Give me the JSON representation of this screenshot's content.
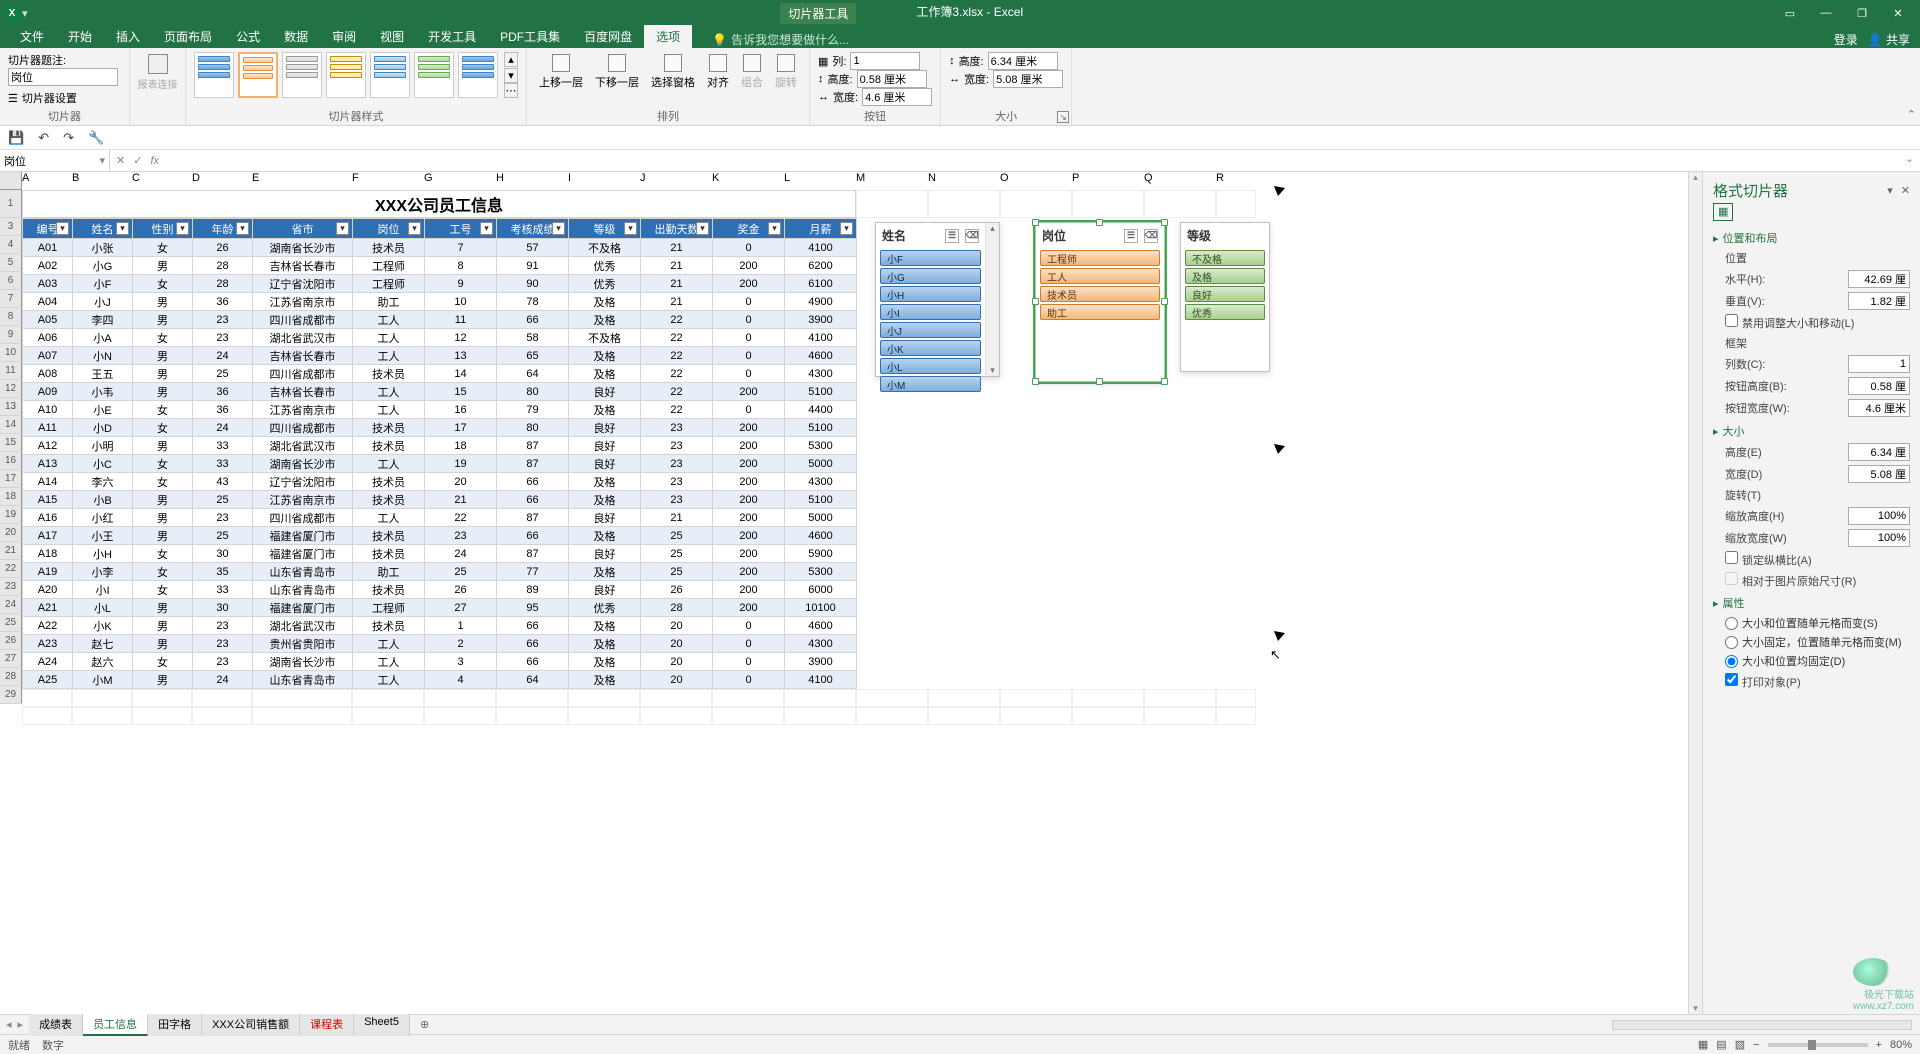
{
  "window": {
    "slicer_tool_tab": "切片器工具",
    "title": "工作簿3.xlsx - Excel",
    "login": "登录",
    "share": "共享"
  },
  "ribbon_tabs": {
    "file": "文件",
    "home": "开始",
    "insert": "插入",
    "page_layout": "页面布局",
    "formulas": "公式",
    "data": "数据",
    "review": "审阅",
    "view": "视图",
    "developer": "开发工具",
    "pdf": "PDF工具集",
    "baidu": "百度网盘",
    "options": "选项",
    "tell_me": "告诉我您想要做什么..."
  },
  "ribbon": {
    "slicer_caption_label": "切片器题注:",
    "slicer_caption_value": "岗位",
    "slicer_settings": "切片器设置",
    "report_connections": "报表连接",
    "group_slicer": "切片器",
    "group_styles": "切片器样式",
    "bring_forward": "上移一层",
    "send_backward": "下移一层",
    "selection_pane": "选择窗格",
    "align": "对齐",
    "group": "组合",
    "rotate": "旋转",
    "group_arrange": "排列",
    "columns_label": "列:",
    "columns_value": "1",
    "btn_height_label": "高度:",
    "btn_height_value": "0.58 厘米",
    "btn_width_label": "宽度:",
    "btn_width_value": "4.6 厘米",
    "group_buttons": "按钮",
    "size_height_label": "高度:",
    "size_height_value": "6.34 厘米",
    "size_width_label": "宽度:",
    "size_width_value": "5.08 厘米",
    "group_size": "大小"
  },
  "name_box": "岗位",
  "fx_label": "fx",
  "columns": [
    "A",
    "B",
    "C",
    "D",
    "E",
    "F",
    "G",
    "H",
    "I",
    "J",
    "K",
    "L",
    "M",
    "N",
    "O",
    "P",
    "Q",
    "R"
  ],
  "table": {
    "title": "XXX公司员工信息",
    "headers": [
      "编号",
      "姓名",
      "性别",
      "年龄",
      "省市",
      "岗位",
      "工号",
      "考核成绩",
      "等级",
      "出勤天数",
      "奖金",
      "月薪"
    ],
    "rows": [
      [
        "A01",
        "小张",
        "女",
        "26",
        "湖南省长沙市",
        "技术员",
        "7",
        "57",
        "不及格",
        "21",
        "0",
        "4100"
      ],
      [
        "A02",
        "小G",
        "男",
        "28",
        "吉林省长春市",
        "工程师",
        "8",
        "91",
        "优秀",
        "21",
        "200",
        "6200"
      ],
      [
        "A03",
        "小F",
        "女",
        "28",
        "辽宁省沈阳市",
        "工程师",
        "9",
        "90",
        "优秀",
        "21",
        "200",
        "6100"
      ],
      [
        "A04",
        "小J",
        "男",
        "36",
        "江苏省南京市",
        "助工",
        "10",
        "78",
        "及格",
        "21",
        "0",
        "4900"
      ],
      [
        "A05",
        "李四",
        "男",
        "23",
        "四川省成都市",
        "工人",
        "11",
        "66",
        "及格",
        "22",
        "0",
        "3900"
      ],
      [
        "A06",
        "小A",
        "女",
        "23",
        "湖北省武汉市",
        "工人",
        "12",
        "58",
        "不及格",
        "22",
        "0",
        "4100"
      ],
      [
        "A07",
        "小N",
        "男",
        "24",
        "吉林省长春市",
        "工人",
        "13",
        "65",
        "及格",
        "22",
        "0",
        "4600"
      ],
      [
        "A08",
        "王五",
        "男",
        "25",
        "四川省成都市",
        "技术员",
        "14",
        "64",
        "及格",
        "22",
        "0",
        "4300"
      ],
      [
        "A09",
        "小韦",
        "男",
        "36",
        "吉林省长春市",
        "工人",
        "15",
        "80",
        "良好",
        "22",
        "200",
        "5100"
      ],
      [
        "A10",
        "小E",
        "女",
        "36",
        "江苏省南京市",
        "工人",
        "16",
        "79",
        "及格",
        "22",
        "0",
        "4400"
      ],
      [
        "A11",
        "小D",
        "女",
        "24",
        "四川省成都市",
        "技术员",
        "17",
        "80",
        "良好",
        "23",
        "200",
        "5100"
      ],
      [
        "A12",
        "小明",
        "男",
        "33",
        "湖北省武汉市",
        "技术员",
        "18",
        "87",
        "良好",
        "23",
        "200",
        "5300"
      ],
      [
        "A13",
        "小C",
        "女",
        "33",
        "湖南省长沙市",
        "工人",
        "19",
        "87",
        "良好",
        "23",
        "200",
        "5000"
      ],
      [
        "A14",
        "李六",
        "女",
        "43",
        "辽宁省沈阳市",
        "技术员",
        "20",
        "66",
        "及格",
        "23",
        "200",
        "4300"
      ],
      [
        "A15",
        "小B",
        "男",
        "25",
        "江苏省南京市",
        "技术员",
        "21",
        "66",
        "及格",
        "23",
        "200",
        "5100"
      ],
      [
        "A16",
        "小红",
        "男",
        "23",
        "四川省成都市",
        "工人",
        "22",
        "87",
        "良好",
        "21",
        "200",
        "5000"
      ],
      [
        "A17",
        "小王",
        "男",
        "25",
        "福建省厦门市",
        "技术员",
        "23",
        "66",
        "及格",
        "25",
        "200",
        "4600"
      ],
      [
        "A18",
        "小H",
        "女",
        "30",
        "福建省厦门市",
        "技术员",
        "24",
        "87",
        "良好",
        "25",
        "200",
        "5900"
      ],
      [
        "A19",
        "小李",
        "女",
        "35",
        "山东省青岛市",
        "助工",
        "25",
        "77",
        "及格",
        "25",
        "200",
        "5300"
      ],
      [
        "A20",
        "小I",
        "女",
        "33",
        "山东省青岛市",
        "技术员",
        "26",
        "89",
        "良好",
        "26",
        "200",
        "6000"
      ],
      [
        "A21",
        "小L",
        "男",
        "30",
        "福建省厦门市",
        "工程师",
        "27",
        "95",
        "优秀",
        "28",
        "200",
        "10100"
      ],
      [
        "A22",
        "小K",
        "男",
        "23",
        "湖北省武汉市",
        "技术员",
        "1",
        "66",
        "及格",
        "20",
        "0",
        "4600"
      ],
      [
        "A23",
        "赵七",
        "男",
        "23",
        "贵州省贵阳市",
        "工人",
        "2",
        "66",
        "及格",
        "20",
        "0",
        "4300"
      ],
      [
        "A24",
        "赵六",
        "女",
        "23",
        "湖南省长沙市",
        "工人",
        "3",
        "66",
        "及格",
        "20",
        "0",
        "3900"
      ],
      [
        "A25",
        "小M",
        "男",
        "24",
        "山东省青岛市",
        "工人",
        "4",
        "64",
        "及格",
        "20",
        "0",
        "4100"
      ]
    ]
  },
  "slicers": {
    "name": {
      "title": "姓名",
      "items": [
        "小F",
        "小G",
        "小H",
        "小I",
        "小J",
        "小K",
        "小L",
        "小M"
      ]
    },
    "position": {
      "title": "岗位",
      "items": [
        "工程师",
        "工人",
        "技术员",
        "助工"
      ]
    },
    "grade": {
      "title": "等级",
      "items": [
        "不及格",
        "及格",
        "良好",
        "优秀"
      ]
    }
  },
  "side_pane": {
    "title": "格式切片器",
    "sec_position": "位置和布局",
    "position_label": "位置",
    "horizontal": "水平(H):",
    "horizontal_val": "42.69 厘",
    "vertical": "垂直(V):",
    "vertical_val": "1.82 厘",
    "disable_resize": "禁用调整大小和移动(L)",
    "frame": "框架",
    "columns": "列数(C):",
    "columns_val": "1",
    "btn_height": "按钮高度(B):",
    "btn_height_val": "0.58 厘",
    "btn_width": "按钮宽度(W):",
    "btn_width_val": "4.6 厘米",
    "sec_size": "大小",
    "height": "高度(E)",
    "height_val": "6.34 厘",
    "width": "宽度(D)",
    "width_val": "5.08 厘",
    "rotate": "旋转(T)",
    "scale_h": "缩放高度(H)",
    "scale_h_val": "100%",
    "scale_w": "缩放宽度(W)",
    "scale_w_val": "100%",
    "lock_aspect": "锁定纵横比(A)",
    "relative": "相对于图片原始尺寸(R)",
    "sec_props": "属性",
    "opt1": "大小和位置随单元格而变(S)",
    "opt2": "大小固定，位置随单元格而变(M)",
    "opt3": "大小和位置均固定(D)",
    "print_obj": "打印对象(P)"
  },
  "sheet_tabs": {
    "tabs": [
      {
        "label": "成绩表",
        "active": false
      },
      {
        "label": "员工信息",
        "active": true
      },
      {
        "label": "田字格",
        "active": false
      },
      {
        "label": "XXX公司销售额",
        "active": false
      },
      {
        "label": "课程表",
        "active": false,
        "red": true
      },
      {
        "label": "Sheet5",
        "active": false
      }
    ]
  },
  "status": {
    "ready": "就绪",
    "lang": "数字",
    "zoom": "80%"
  },
  "watermark": {
    "name": "极光下载站",
    "url": "www.xz7.com"
  }
}
